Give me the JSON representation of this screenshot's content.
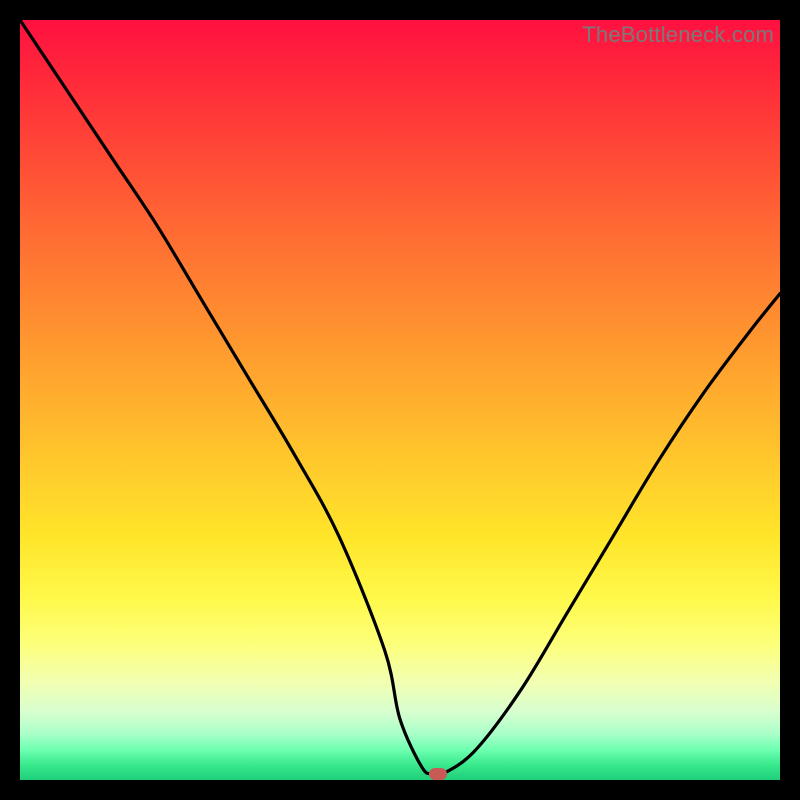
{
  "watermark": "TheBottleneck.com",
  "chart_data": {
    "type": "line",
    "title": "",
    "xlabel": "",
    "ylabel": "",
    "xlim": [
      0,
      1
    ],
    "ylim": [
      0,
      1
    ],
    "series": [
      {
        "name": "bottleneck-curve",
        "x": [
          0.0,
          0.06,
          0.12,
          0.18,
          0.24,
          0.3,
          0.36,
          0.42,
          0.48,
          0.5,
          0.53,
          0.545,
          0.56,
          0.6,
          0.66,
          0.72,
          0.78,
          0.84,
          0.9,
          0.96,
          1.0
        ],
        "y": [
          1.0,
          0.91,
          0.82,
          0.73,
          0.63,
          0.53,
          0.43,
          0.32,
          0.17,
          0.08,
          0.015,
          0.01,
          0.01,
          0.04,
          0.12,
          0.22,
          0.32,
          0.42,
          0.51,
          0.59,
          0.64
        ]
      }
    ],
    "annotations": [
      {
        "name": "optimum-marker",
        "x": 0.55,
        "y": 0.008
      }
    ],
    "gradient_background": {
      "top": "#ff1040",
      "bottom": "#1fce7a",
      "meaning": "red-high to green-low bottleneck"
    }
  }
}
